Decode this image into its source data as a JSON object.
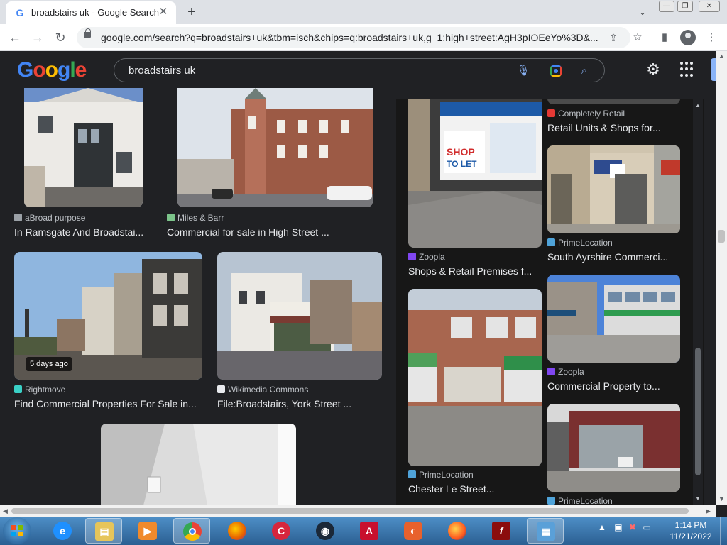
{
  "browser": {
    "tab_title": "broadstairs uk - Google Search",
    "tab_favicon": "G",
    "close_tab": "✕",
    "new_tab": "+",
    "tab_search": "⌄",
    "url": "google.com/search?q=broadstairs+uk&tbm=isch&chips=q:broadstairs+uk,g_1:high+street:AgH3pIOEeYo%3D&..."
  },
  "google": {
    "logo_letters": [
      "G",
      "o",
      "o",
      "g",
      "l",
      "e"
    ],
    "logo_colors": [
      "#4285f4",
      "#ea4335",
      "#fbbc04",
      "#4285f4",
      "#34a853",
      "#ea4335"
    ],
    "query": "broadstairs uk"
  },
  "results_left": [
    {
      "source": "aBroad purpose",
      "title": "In Ramsgate And Broadstai...",
      "source_color": "#9aa0a6"
    },
    {
      "source": "Miles & Barr",
      "title": "Commercial for sale in High Street ...",
      "source_color": "#7cc48a"
    },
    {
      "source": "Rightmove",
      "title": "Find Commercial Properties For Sale in...",
      "source_color": "#3ad0c6",
      "badge": "5 days ago"
    },
    {
      "source": "Wikimedia Commons",
      "title": "File:Broadstairs, York Street ...",
      "source_color": "#e8eaed"
    }
  ],
  "results_panel": [
    {
      "source": "Completely Retail",
      "title": "Retail Units & Shops for...",
      "source_color": "#e53935"
    },
    {
      "source": "Zoopla",
      "title": "Shops & Retail Premises f...",
      "source_color": "#8046f1"
    },
    {
      "source": "PrimeLocation",
      "title": "South Ayrshire Commerci...",
      "source_color": "#4fa3d9"
    },
    {
      "source": "Zoopla",
      "title": "Commercial Property to...",
      "source_color": "#8046f1"
    },
    {
      "source": "PrimeLocation",
      "title": "Chester Le Street...",
      "source_color": "#4fa3d9"
    },
    {
      "source": "PrimeLocation",
      "title": "",
      "source_color": "#4fa3d9"
    }
  ],
  "taskbar": {
    "time": "1:14 PM",
    "date": "11/21/2022"
  }
}
